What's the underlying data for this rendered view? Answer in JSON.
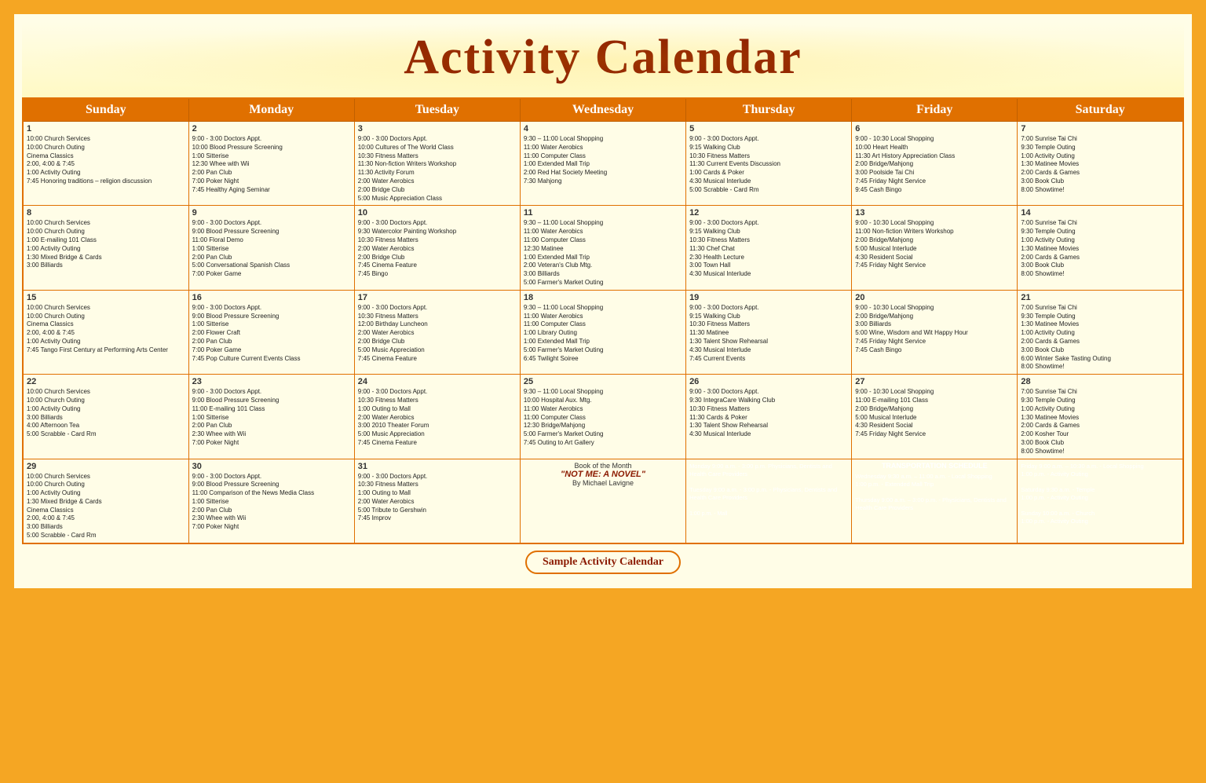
{
  "title": "Activity Calendar",
  "footer": "Sample Activity Calendar",
  "days": [
    "Sunday",
    "Monday",
    "Tuesday",
    "Wednesday",
    "Thursday",
    "Friday",
    "Saturday"
  ],
  "weeks": [
    {
      "cells": [
        {
          "day": 1,
          "events": [
            "10:00 Church Services",
            "10:00 Church Outing",
            "Cinema Classics",
            "2:00, 4:00 & 7:45",
            "1:00 Activity Outing",
            "7:45 Honoring traditions – religion discussion"
          ]
        },
        {
          "day": 2,
          "events": [
            "9:00  -  3:00 Doctors Appt.",
            "10:00 Blood Pressure Screening",
            "1:00 Sitterise",
            "12:30 Whee with Wii",
            "2:00 Pan Club",
            "7:00 Poker Night",
            "7:45 Healthy Aging Seminar"
          ]
        },
        {
          "day": 3,
          "events": [
            "9:00  -  3:00 Doctors Appt.",
            "10:00 Cultures of The World Class",
            "10:30 Fitness Matters",
            "11:30 Non-fiction Writers Workshop",
            "11:30 Activity Forum",
            "2:00 Water Aerobics",
            "2:00 Bridge Club",
            "5:00 Music Appreciation Class"
          ]
        },
        {
          "day": 4,
          "events": [
            "9:30 – 11:00 Local Shopping",
            "11:00 Water Aerobics",
            "11:00 Computer Class",
            "1:00 Extended Mall Trip",
            "2:00 Red Hat Society Meeting",
            "7:30 Mahjong"
          ]
        },
        {
          "day": 5,
          "events": [
            "9:00  -  3:00 Doctors Appt.",
            "9:15 Walking Club",
            "10:30 Fitness Matters",
            "11:30 Current Events Discussion",
            "1:00 Cards & Poker",
            "4:30 Musical Interlude",
            "5:00 Scrabble - Card Rm"
          ]
        },
        {
          "day": 6,
          "events": [
            "9:00  -  10:30 Local Shopping",
            "10:00 Heart Health",
            "11:30 Art History Appreciation Class",
            "2:00 Bridge/Mahjong",
            "3:00 Poolside Tai Chi",
            "7:45 Friday Night Service",
            "9:45 Cash Bingo"
          ]
        },
        {
          "day": 7,
          "events": [
            "7:00 Sunrise Tai Chi",
            "9:30 Temple Outing",
            "1:00 Activity Outing",
            "1:30 Matinee Movies",
            "2:00 Cards & Games",
            "3:00 Book Club",
            "8:00 Showtime!"
          ]
        }
      ]
    },
    {
      "cells": [
        {
          "day": 8,
          "events": [
            "10:00 Church Services",
            "10:00 Church Outing",
            "1:00 E-mailing 101 Class",
            "1:00 Activity Outing",
            "1:30 Mixed Bridge & Cards",
            "3:00 Billiards"
          ]
        },
        {
          "day": 9,
          "events": [
            "9:00  -  3:00 Doctors Appt.",
            "9:00 Blood Pressure Screening",
            "11:00 Floral Demo",
            "1:00 Sitterise",
            "2:00 Pan Club",
            "5:00 Conversational Spanish Class",
            "7:00 Poker Game"
          ]
        },
        {
          "day": 10,
          "events": [
            "9:00  -  3:00 Doctors Appt.",
            "9:30 Watercolor Painting Workshop",
            "10:30 Fitness Matters",
            "2:00 Water Aerobics",
            "2:00 Bridge Club",
            "7:45 Cinema Feature",
            "7:45 Bingo"
          ]
        },
        {
          "day": 11,
          "events": [
            "9:30 – 11:00 Local Shopping",
            "11:00 Water Aerobics",
            "11:00 Computer Class",
            "12:30 Matinee",
            "1:00 Extended Mall Trip",
            "2:00 Veteran's Club Mtg.",
            "3:00 Billiards",
            "5:00 Farmer's Market Outing"
          ]
        },
        {
          "day": 12,
          "events": [
            "9:00  -  3:00 Doctors Appt.",
            "9:15 Walking Club",
            "10:30 Fitness Matters",
            "11:30 Chef Chat",
            "2:30 Health Lecture",
            "3:00 Town Hall",
            "4:30 Musical Interlude"
          ]
        },
        {
          "day": 13,
          "events": [
            "9:00  -  10:30 Local Shopping",
            "11:00 Non-fiction Writers Workshop",
            "2:00 Bridge/Mahjong",
            "5:00 Musical Interlude",
            "4:30 Resident Social",
            "7:45 Friday Night Service"
          ]
        },
        {
          "day": 14,
          "events": [
            "7:00 Sunrise Tai Chi",
            "9:30 Temple Outing",
            "1:00 Activity Outing",
            "1:30 Matinee Movies",
            "2:00 Cards & Games",
            "3:00 Book Club",
            "8:00 Showtime!"
          ]
        }
      ]
    },
    {
      "cells": [
        {
          "day": 15,
          "events": [
            "10:00 Church Services",
            "10:00 Church Outing",
            "Cinema Classics",
            "2:00, 4:00 & 7:45",
            "1:00 Activity Outing",
            "7:45 Tango First Century at Performing Arts Center"
          ]
        },
        {
          "day": 16,
          "events": [
            "9:00  -  3:00 Doctors Appt.",
            "9:00 Blood Pressure Screening",
            "1:00 Sitterise",
            "2:00 Flower Craft",
            "2:00 Pan Club",
            "7:00 Poker Game",
            "7:45 Pop Culture Current Events Class"
          ]
        },
        {
          "day": 17,
          "events": [
            "9:00  -  3:00 Doctors Appt.",
            "10:30 Fitness Matters",
            "12:00 Birthday Luncheon",
            "2:00 Water Aerobics",
            "2:00 Bridge Club",
            "5:00 Music Appreciation",
            "7:45 Cinema Feature"
          ]
        },
        {
          "day": 18,
          "events": [
            "9:30 – 11:00 Local Shopping",
            "11:00 Water Aerobics",
            "11:00 Computer Class",
            "1:00 Library Outing",
            "1:00 Extended Mall Trip",
            "5:00 Farmer's Market Outing",
            "6:45 Twilight Soiree"
          ]
        },
        {
          "day": 19,
          "events": [
            "9:00  -  3:00 Doctors Appt.",
            "9:15 Walking Club",
            "10:30 Fitness Matters",
            "11:30 Matinee",
            "1:30 Talent Show Rehearsal",
            "4:30 Musical Interlude",
            "7:45 Current Events"
          ]
        },
        {
          "day": 20,
          "events": [
            "9:00  -  10:30 Local Shopping",
            "2:00 Bridge/Mahjong",
            "3:00 Billiards",
            "5:00 Wine, Wisdom and Wit Happy Hour",
            "7:45 Friday Night Service",
            "7:45 Cash Bingo"
          ]
        },
        {
          "day": 21,
          "events": [
            "7:00 Sunrise Tai Chi",
            "9:30 Temple Outing",
            "1:30 Matinee Movies",
            "1:00 Activity Outing",
            "2:00 Cards & Games",
            "3:00 Book Club",
            "6:00 Winter Sake Tasting Outing",
            "8:00 Showtime!"
          ]
        }
      ]
    },
    {
      "cells": [
        {
          "day": 22,
          "events": [
            "10:00 Church Services",
            "10:00 Church Outing",
            "1:00 Activity Outing",
            "3:00 Billiards",
            "4:00 Afternoon Tea",
            "5:00 Scrabble - Card Rm"
          ]
        },
        {
          "day": 23,
          "events": [
            "9:00  -  3:00 Doctors Appt.",
            "9:00 Blood Pressure Screening",
            "11:00 E-mailing 101 Class",
            "1:00 Sitterise",
            "2:00 Pan Club",
            "2:30 Whee with Wii",
            "7:00 Poker Night"
          ]
        },
        {
          "day": 24,
          "events": [
            "9:00  -  3:00 Doctors Appt.",
            "10:30 Fitness Matters",
            "1:00 Outing to Mall",
            "2:00 Water Aerobics",
            "3:00 2010 Theater Forum",
            "5:00 Music Appreciation",
            "7:45 Cinema Feature"
          ]
        },
        {
          "day": 25,
          "events": [
            "9:30 – 11:00 Local Shopping",
            "10:00 Hospital Aux. Mtg.",
            "11:00 Water Aerobics",
            "11:00 Computer Class",
            "12:30 Bridge/Mahjong",
            "5:00 Farmer's Market Outing",
            "7:45 Outing to Art Gallery"
          ]
        },
        {
          "day": 26,
          "events": [
            "9:00  -  3:00 Doctors Appt.",
            "9:30 IntegraCare Walking Club",
            "10:30 Fitness Matters",
            "11:30 Cards & Poker",
            "1:30 Talent Show Rehearsal",
            "4:30 Musical Interlude"
          ]
        },
        {
          "day": 27,
          "events": [
            "9:00  -  10:30 Local Shopping",
            "11:00 E-mailing 101 Class",
            "2:00 Bridge/Mahjong",
            "5:00 Musical Interlude",
            "4:30 Resident Social",
            "7:45 Friday Night Service"
          ]
        },
        {
          "day": 28,
          "events": [
            "7:00 Sunrise Tai Chi",
            "9:30 Temple Outing",
            "1:00 Activity Outing",
            "1:30 Matinee Movies",
            "2:00 Cards & Games",
            "2:00 Kosher Tour",
            "3:00 Book Club",
            "8:00 Showtime!"
          ]
        }
      ]
    },
    {
      "cells": [
        {
          "day": 29,
          "events": [
            "10:00 Church Services",
            "10:00 Church Outing",
            "1:00 Activity Outing",
            "1:30 Mixed Bridge & Cards",
            "Cinema Classics",
            "2:00, 4:00 & 7:45",
            "3:00 Billiards",
            "5:00 Scrabble - Card Rm"
          ]
        },
        {
          "day": 30,
          "events": [
            "9:00  -  3:00 Doctors Appt.",
            "9:00 Blood Pressure Screening",
            "11:00 Comparison of the News Media Class",
            "1:00 Sitterise",
            "2:00 Pan Club",
            "2:30 Whee with Wii",
            "7:00 Poker Night"
          ]
        },
        {
          "day": 31,
          "events": [
            "9:00  -  3:00 Doctors Appt.",
            "10:30 Fitness Matters",
            "1:00 Outing to Mall",
            "2:00 Water Aerobics",
            "5:00 Tribute to Gershwin",
            "7:45 Improv"
          ]
        },
        {
          "book": true
        },
        {
          "transport_monday": true
        },
        {
          "transport_wed_thu": true
        },
        {
          "transport_fri_sat_sun": true
        }
      ]
    }
  ],
  "book_of_month": {
    "label": "Book of the Month",
    "title": "\"NOT ME: A NOVEL\"",
    "author": "By Michael Lavigne"
  },
  "transport": {
    "title": "TRANSPORTATION SCHEDULE",
    "monday": "Monday 9:00 a.m. - 3:00 p.m. Physicians, Dentists and Health Care Providers",
    "tuesday": "Tuesday 9:00 a.m. - 3:00 p.m. - Physicians, Dentists and Health Care Providers",
    "wednesday": "Wednesday 9:30 a.m. – 11:00 a.m. - Local Shopping",
    "thursday_time": "1:00 p.m. - Extended Mall Trip",
    "thursday": "Thursday 9:00 a.m. – 3:00 p.m. - Physicians, Dentists and Health Care Providers",
    "friday": "Friday 9:00 a.m. – 10:30 a.m. - Local Shopping",
    "friday_pm": "1:00 p.m. - Activity Outing",
    "saturday": "Saturday 9:30 a.m. - Temple",
    "saturday_pm": "1:00 p.m. - Activity Outing",
    "sunday": "Sunday 10:00 a.m. - Church",
    "sunday_pm": "1:00 p.m. - Activity Outing",
    "monday_mall": "1:00 p.m. - Mall"
  }
}
